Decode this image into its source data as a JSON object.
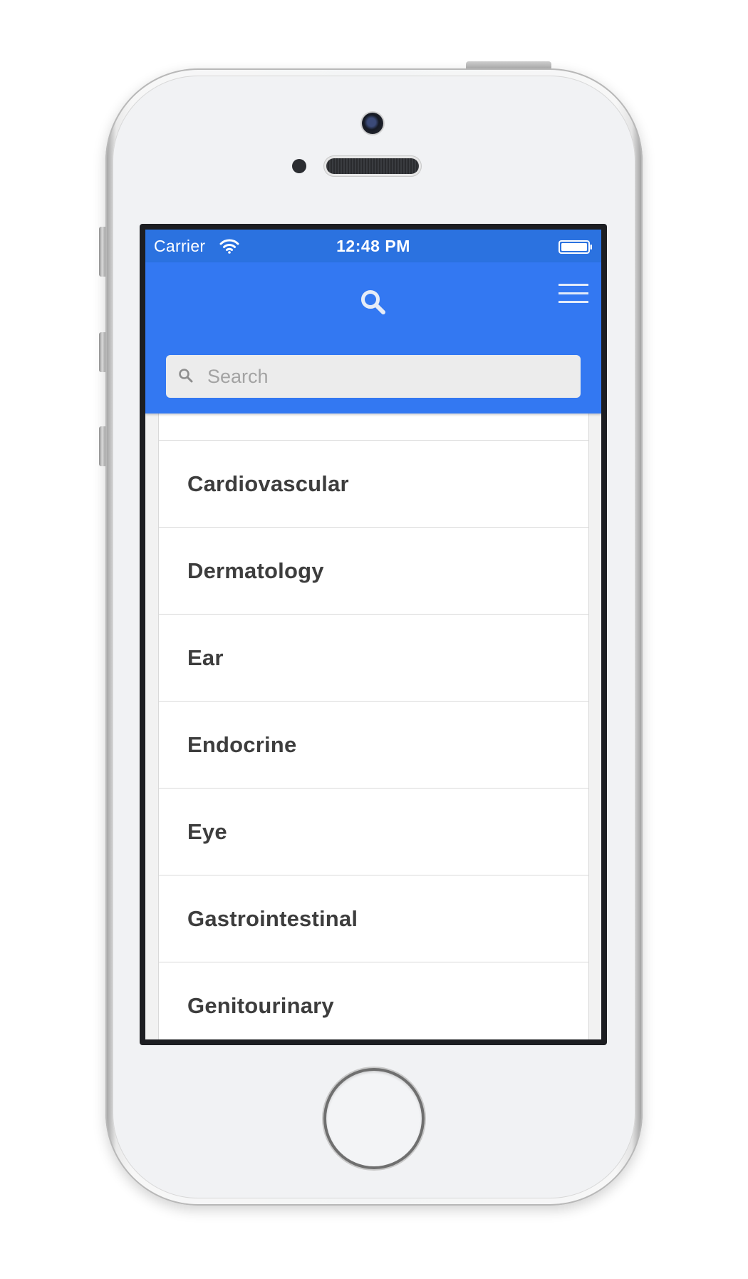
{
  "status_bar": {
    "carrier": "Carrier",
    "time": "12:48 PM",
    "wifi_icon": "wifi-icon",
    "battery_icon": "battery-full-icon"
  },
  "header": {
    "search_icon": "search-icon",
    "menu_icon": "hamburger-menu-icon",
    "accent_color": "#3378f2",
    "status_bar_color": "#2b72e0"
  },
  "search": {
    "placeholder": "Search",
    "value": ""
  },
  "categories": [
    {
      "label": "Cardiovascular"
    },
    {
      "label": "Dermatology"
    },
    {
      "label": "Ear"
    },
    {
      "label": "Endocrine"
    },
    {
      "label": "Eye"
    },
    {
      "label": "Gastrointestinal"
    },
    {
      "label": "Genitourinary"
    }
  ]
}
